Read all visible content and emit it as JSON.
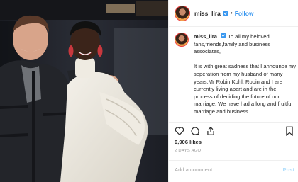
{
  "post": {
    "username": "miss_lira",
    "follow_label": "Follow",
    "separator": "•",
    "caption_username": "miss_lira",
    "caption_p1": "To all my beloved fans,friends,family and business associates,",
    "caption_p2": "It is with great sadness that I announce my seperation from my husband of many years,Mr Robin Kohl. Robin and I are currently living apart and are in the process of deciding the future of our marriage. We have had a long and fruitful marriage and business",
    "likes": "9,906 likes",
    "time_ago": "2 DAYS AGO",
    "comment_placeholder": "Add a comment…",
    "post_label": "Post"
  },
  "colors": {
    "link_blue": "#3897f0",
    "post_disabled": "#b2dffc",
    "verified_blue": "#3897f0"
  },
  "icons": [
    "verified-badge-icon",
    "heart-icon",
    "comment-icon",
    "share-icon",
    "bookmark-icon"
  ]
}
